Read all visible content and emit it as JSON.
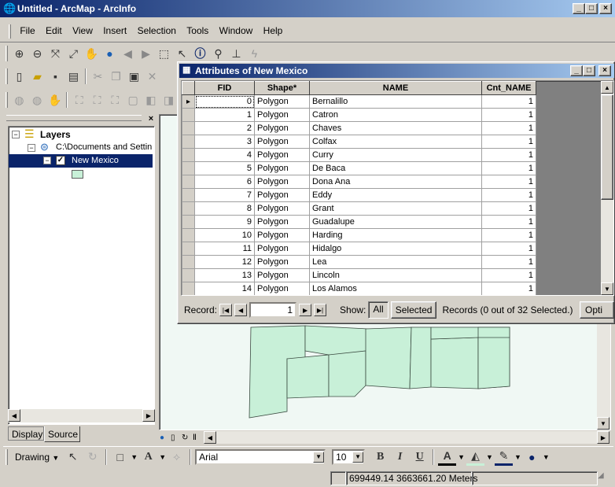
{
  "app": {
    "title": "Untitled - ArcMap - ArcInfo"
  },
  "menu": [
    "File",
    "Edit",
    "View",
    "Insert",
    "Selection",
    "Tools",
    "Window",
    "Help"
  ],
  "toc": {
    "root": "Layers",
    "source": "C:\\Documents and Settin",
    "layer": "New Mexico",
    "tabs": [
      "Display",
      "Source"
    ]
  },
  "attributes": {
    "title": "Attributes of New Mexico",
    "columns": [
      "FID",
      "Shape*",
      "NAME",
      "Cnt_NAME"
    ],
    "rows": [
      [
        "0",
        "Polygon",
        "Bernalillo",
        "1"
      ],
      [
        "1",
        "Polygon",
        "Catron",
        "1"
      ],
      [
        "2",
        "Polygon",
        "Chaves",
        "1"
      ],
      [
        "3",
        "Polygon",
        "Colfax",
        "1"
      ],
      [
        "4",
        "Polygon",
        "Curry",
        "1"
      ],
      [
        "5",
        "Polygon",
        "De Baca",
        "1"
      ],
      [
        "6",
        "Polygon",
        "Dona Ana",
        "1"
      ],
      [
        "7",
        "Polygon",
        "Eddy",
        "1"
      ],
      [
        "8",
        "Polygon",
        "Grant",
        "1"
      ],
      [
        "9",
        "Polygon",
        "Guadalupe",
        "1"
      ],
      [
        "10",
        "Polygon",
        "Harding",
        "1"
      ],
      [
        "11",
        "Polygon",
        "Hidalgo",
        "1"
      ],
      [
        "12",
        "Polygon",
        "Lea",
        "1"
      ],
      [
        "13",
        "Polygon",
        "Lincoln",
        "1"
      ],
      [
        "14",
        "Polygon",
        "Los Alamos",
        "1"
      ]
    ],
    "footer": {
      "record_label": "Record:",
      "record_value": "1",
      "show_label": "Show:",
      "all": "All",
      "selected": "Selected",
      "records_text": "Records (0 out of 32 Selected.)",
      "options": "Opti"
    }
  },
  "drawing": {
    "label": "Drawing",
    "font": "Arial",
    "size": "10",
    "bold": "B",
    "italic": "I",
    "underline": "U",
    "text_tool": "A"
  },
  "status": {
    "coords": "699449.14  3663661.20 Meters"
  },
  "colors": {
    "titlebar": "#0a246a",
    "selection": "#0a246a",
    "county_fill": "#c8f0d8"
  }
}
